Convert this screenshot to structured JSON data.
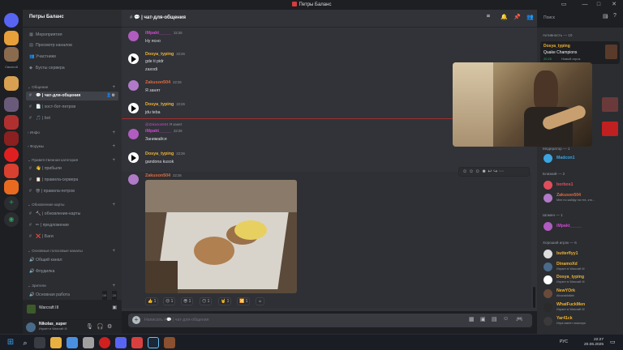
{
  "window": {
    "title": "Петры Баланс"
  },
  "server": {
    "name": "Петры Баланс",
    "rail_label": "Связной"
  },
  "sidebar": {
    "top_items": [
      "Мероприятия",
      "Просмотр каналов",
      "Участники",
      "Бусты сервера"
    ],
    "cat_chat": "Общение",
    "chat_channels": [
      {
        "icon": "💬",
        "name": "| чат-для-общения"
      },
      {
        "icon": "📄",
        "name": "| хост-бот-петров"
      },
      {
        "icon": "🎵",
        "name": "| bot"
      }
    ],
    "cat_info": "Инфо",
    "cat_forums": "Форумы",
    "cat_welcome": "Приветственная категория",
    "welcome_channels": [
      {
        "icon": "👋",
        "name": "| прибыли"
      },
      {
        "icon": "📋",
        "name": "| правила-сервера"
      },
      {
        "icon": "😎",
        "name": "| правила-петров"
      }
    ],
    "cat_updates": "Обновление карты",
    "update_channels": [
      {
        "icon": "🔨",
        "name": "| обновление-карты"
      },
      {
        "icon": "✏",
        "name": "| предложение"
      },
      {
        "icon": "❌",
        "name": "| Баги"
      }
    ],
    "cat_voice": "Основные голосовые каналы",
    "voice_channels": [
      "Общий канал",
      "Флудилка"
    ],
    "cat_viewers": "Зрители",
    "viewer_channel": "Основная работа",
    "viewer_count_a": "00",
    "viewer_count_b": "20"
  },
  "game_activity": {
    "game": "Warcraft III"
  },
  "user": {
    "name": "Nikolas_super",
    "status": "Играет в Warcraft III"
  },
  "header": {
    "channel": "| чат-для-общения"
  },
  "search": {
    "placeholder": "Поиск"
  },
  "messages": [
    {
      "author": "iMpakt_____",
      "time": "22:26",
      "text": "Ну ясно",
      "color": "purple"
    },
    {
      "author": "Dosya_typing",
      "time": "22:26",
      "text": "gde ti pidr",
      "text2": "zaxodi",
      "color": "gold"
    },
    {
      "author": "Zakuson504",
      "time": "22:26",
      "text": "Я занят",
      "color": "gold"
    },
    {
      "author": "Dosya_typing",
      "time": "22:26",
      "text": "jdu teba",
      "color": "gold"
    },
    {
      "reply_to": "@Zakuson504",
      "reply_text": "Я занят",
      "author": "iMpakt_____",
      "time": "22:26",
      "text": "Занимайся",
      "color": "purple"
    },
    {
      "author": "Dosya_typing",
      "time": "22:26",
      "text": "gandona kusok",
      "color": "gold"
    },
    {
      "author": "Zakuson504",
      "time": "22:26",
      "text": "",
      "color": "gold"
    }
  ],
  "reactions": [
    {
      "emoji": "👍",
      "count": "1"
    },
    {
      "emoji": "😐",
      "count": "1"
    },
    {
      "emoji": "😎",
      "count": "1"
    },
    {
      "emoji": "😶",
      "count": "1"
    },
    {
      "emoji": "🤘",
      "count": "1"
    },
    {
      "emoji": "🔀",
      "count": "1"
    }
  ],
  "input": {
    "placeholder": "Написать #💬 | чат-для-общения"
  },
  "members": {
    "activity_header": "Активность — 10",
    "activity_card": {
      "name": "Dosya_typing",
      "game": "Quake Champions",
      "meta": "20:26",
      "meta2": "Новый игрок"
    },
    "group_blue": "Модератор — 1",
    "mod": {
      "name": "Madcon1",
      "color": "#3ba5e0"
    },
    "group_close": "Близкий — 2",
    "close": [
      {
        "name": "borbos1",
        "color": "#e04e5c",
        "sub": ""
      },
      {
        "name": "Zakuson504",
        "color": "#e06a3c",
        "sub": "Мне по кайфу на тех, кто..."
      }
    ],
    "group_jesters": "Шомен — 1",
    "jesters": [
      {
        "name": "iMpakt_____",
        "color": "#c94ac9",
        "sub": ""
      }
    ],
    "group_good": "Хороший игрок — 6",
    "good": [
      {
        "name": "butterflyy1",
        "color": "#f0b232",
        "sub": ""
      },
      {
        "name": "DinamoXd",
        "color": "#f0b232",
        "sub": "Играет в Warcraft III"
      },
      {
        "name": "Dosya_typing",
        "color": "#f0b232",
        "sub": "Играет в Warcraft III"
      },
      {
        "name": "NewYOrk",
        "color": "#f0b232",
        "sub": "Abuzaidullah"
      },
      {
        "name": "WhatFuckMen",
        "color": "#f0b232",
        "sub": "Играет в Warcraft III"
      },
      {
        "name": "Yar41ck",
        "color": "#f0b232",
        "sub": "Игра имеет опасную"
      }
    ]
  },
  "taskbar": {
    "time": "22:27",
    "date": "20.06.2025",
    "lang": "РУС"
  },
  "colors": {
    "accent": "#5865f2",
    "gold": "#f0b232",
    "purple": "#c94ac9",
    "bg": "#313338"
  }
}
